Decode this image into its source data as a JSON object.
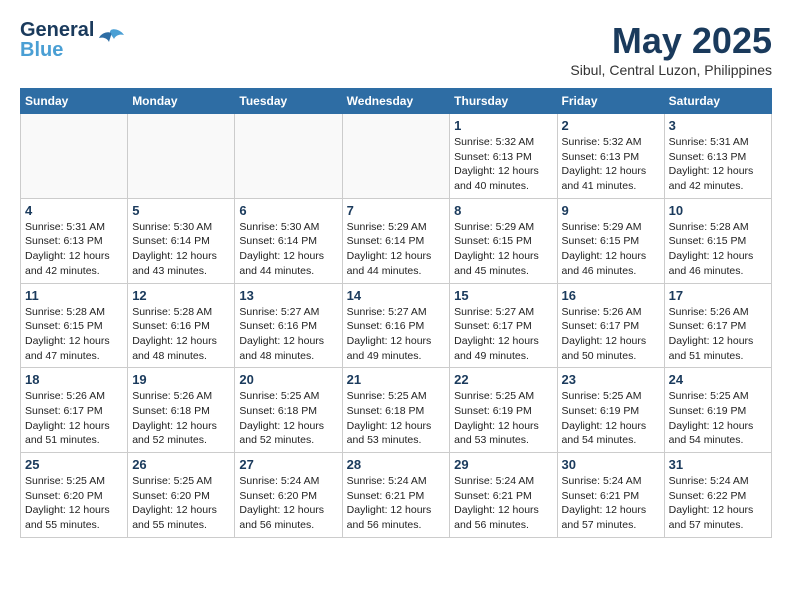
{
  "header": {
    "logo_line1": "General",
    "logo_line2": "Blue",
    "month": "May 2025",
    "location": "Sibul, Central Luzon, Philippines"
  },
  "weekdays": [
    "Sunday",
    "Monday",
    "Tuesday",
    "Wednesday",
    "Thursday",
    "Friday",
    "Saturday"
  ],
  "weeks": [
    [
      {
        "day": "",
        "info": ""
      },
      {
        "day": "",
        "info": ""
      },
      {
        "day": "",
        "info": ""
      },
      {
        "day": "",
        "info": ""
      },
      {
        "day": "1",
        "info": "Sunrise: 5:32 AM\nSunset: 6:13 PM\nDaylight: 12 hours\nand 40 minutes."
      },
      {
        "day": "2",
        "info": "Sunrise: 5:32 AM\nSunset: 6:13 PM\nDaylight: 12 hours\nand 41 minutes."
      },
      {
        "day": "3",
        "info": "Sunrise: 5:31 AM\nSunset: 6:13 PM\nDaylight: 12 hours\nand 42 minutes."
      }
    ],
    [
      {
        "day": "4",
        "info": "Sunrise: 5:31 AM\nSunset: 6:13 PM\nDaylight: 12 hours\nand 42 minutes."
      },
      {
        "day": "5",
        "info": "Sunrise: 5:30 AM\nSunset: 6:14 PM\nDaylight: 12 hours\nand 43 minutes."
      },
      {
        "day": "6",
        "info": "Sunrise: 5:30 AM\nSunset: 6:14 PM\nDaylight: 12 hours\nand 44 minutes."
      },
      {
        "day": "7",
        "info": "Sunrise: 5:29 AM\nSunset: 6:14 PM\nDaylight: 12 hours\nand 44 minutes."
      },
      {
        "day": "8",
        "info": "Sunrise: 5:29 AM\nSunset: 6:15 PM\nDaylight: 12 hours\nand 45 minutes."
      },
      {
        "day": "9",
        "info": "Sunrise: 5:29 AM\nSunset: 6:15 PM\nDaylight: 12 hours\nand 46 minutes."
      },
      {
        "day": "10",
        "info": "Sunrise: 5:28 AM\nSunset: 6:15 PM\nDaylight: 12 hours\nand 46 minutes."
      }
    ],
    [
      {
        "day": "11",
        "info": "Sunrise: 5:28 AM\nSunset: 6:15 PM\nDaylight: 12 hours\nand 47 minutes."
      },
      {
        "day": "12",
        "info": "Sunrise: 5:28 AM\nSunset: 6:16 PM\nDaylight: 12 hours\nand 48 minutes."
      },
      {
        "day": "13",
        "info": "Sunrise: 5:27 AM\nSunset: 6:16 PM\nDaylight: 12 hours\nand 48 minutes."
      },
      {
        "day": "14",
        "info": "Sunrise: 5:27 AM\nSunset: 6:16 PM\nDaylight: 12 hours\nand 49 minutes."
      },
      {
        "day": "15",
        "info": "Sunrise: 5:27 AM\nSunset: 6:17 PM\nDaylight: 12 hours\nand 49 minutes."
      },
      {
        "day": "16",
        "info": "Sunrise: 5:26 AM\nSunset: 6:17 PM\nDaylight: 12 hours\nand 50 minutes."
      },
      {
        "day": "17",
        "info": "Sunrise: 5:26 AM\nSunset: 6:17 PM\nDaylight: 12 hours\nand 51 minutes."
      }
    ],
    [
      {
        "day": "18",
        "info": "Sunrise: 5:26 AM\nSunset: 6:17 PM\nDaylight: 12 hours\nand 51 minutes."
      },
      {
        "day": "19",
        "info": "Sunrise: 5:26 AM\nSunset: 6:18 PM\nDaylight: 12 hours\nand 52 minutes."
      },
      {
        "day": "20",
        "info": "Sunrise: 5:25 AM\nSunset: 6:18 PM\nDaylight: 12 hours\nand 52 minutes."
      },
      {
        "day": "21",
        "info": "Sunrise: 5:25 AM\nSunset: 6:18 PM\nDaylight: 12 hours\nand 53 minutes."
      },
      {
        "day": "22",
        "info": "Sunrise: 5:25 AM\nSunset: 6:19 PM\nDaylight: 12 hours\nand 53 minutes."
      },
      {
        "day": "23",
        "info": "Sunrise: 5:25 AM\nSunset: 6:19 PM\nDaylight: 12 hours\nand 54 minutes."
      },
      {
        "day": "24",
        "info": "Sunrise: 5:25 AM\nSunset: 6:19 PM\nDaylight: 12 hours\nand 54 minutes."
      }
    ],
    [
      {
        "day": "25",
        "info": "Sunrise: 5:25 AM\nSunset: 6:20 PM\nDaylight: 12 hours\nand 55 minutes."
      },
      {
        "day": "26",
        "info": "Sunrise: 5:25 AM\nSunset: 6:20 PM\nDaylight: 12 hours\nand 55 minutes."
      },
      {
        "day": "27",
        "info": "Sunrise: 5:24 AM\nSunset: 6:20 PM\nDaylight: 12 hours\nand 56 minutes."
      },
      {
        "day": "28",
        "info": "Sunrise: 5:24 AM\nSunset: 6:21 PM\nDaylight: 12 hours\nand 56 minutes."
      },
      {
        "day": "29",
        "info": "Sunrise: 5:24 AM\nSunset: 6:21 PM\nDaylight: 12 hours\nand 56 minutes."
      },
      {
        "day": "30",
        "info": "Sunrise: 5:24 AM\nSunset: 6:21 PM\nDaylight: 12 hours\nand 57 minutes."
      },
      {
        "day": "31",
        "info": "Sunrise: 5:24 AM\nSunset: 6:22 PM\nDaylight: 12 hours\nand 57 minutes."
      }
    ]
  ]
}
